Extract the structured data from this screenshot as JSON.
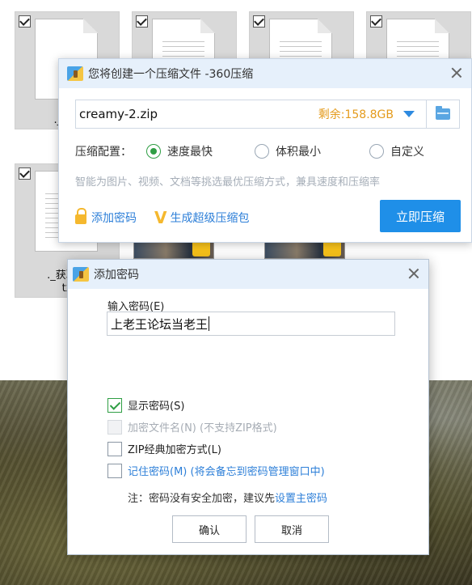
{
  "explorer": {
    "files": [
      {
        "name": "._.DS"
      },
      {
        "name": ""
      },
      {
        "name": ""
      },
      {
        "name": ""
      },
      {
        "name": "._获取最",
        "name2": "tx"
      }
    ]
  },
  "compress_dialog": {
    "title": "您将创建一个压缩文件 -360压缩",
    "filename": "creamy-2.zip",
    "free_space": "剩余:158.8GB",
    "config_label": "压缩配置：",
    "options": [
      {
        "label": "速度最快",
        "selected": true
      },
      {
        "label": "体积最小",
        "selected": false
      },
      {
        "label": "自定义",
        "selected": false
      }
    ],
    "hint": "智能为图片、视频、文档等挑选最优压缩方式，兼具速度和压缩率",
    "add_password": "添加密码",
    "super_package": "生成超级压缩包",
    "compress_now": "立即压缩"
  },
  "password_dialog": {
    "title": "添加密码",
    "input_label": "输入密码(E)",
    "password_value": "上老王论坛当老王",
    "show_password": {
      "label": "显示密码(S)",
      "checked": true
    },
    "encrypt_filenames": {
      "label": "加密文件名(N) (不支持ZIP格式)",
      "checked": false,
      "disabled": true
    },
    "zip_classic": {
      "label": "ZIP经典加密方式(L)",
      "checked": false
    },
    "remember": {
      "label": "记住密码(M) (将会备忘到密码管理窗口中)",
      "checked": false
    },
    "note_prefix": "注：密码没有安全加密，建议先",
    "note_link": "设置主密码",
    "ok": "确认",
    "cancel": "取消"
  },
  "colors": {
    "accent_blue": "#1f8fe8",
    "check_green": "#2f9e44",
    "space_orange": "#e49b1c",
    "link_blue": "#2d7fd8"
  }
}
